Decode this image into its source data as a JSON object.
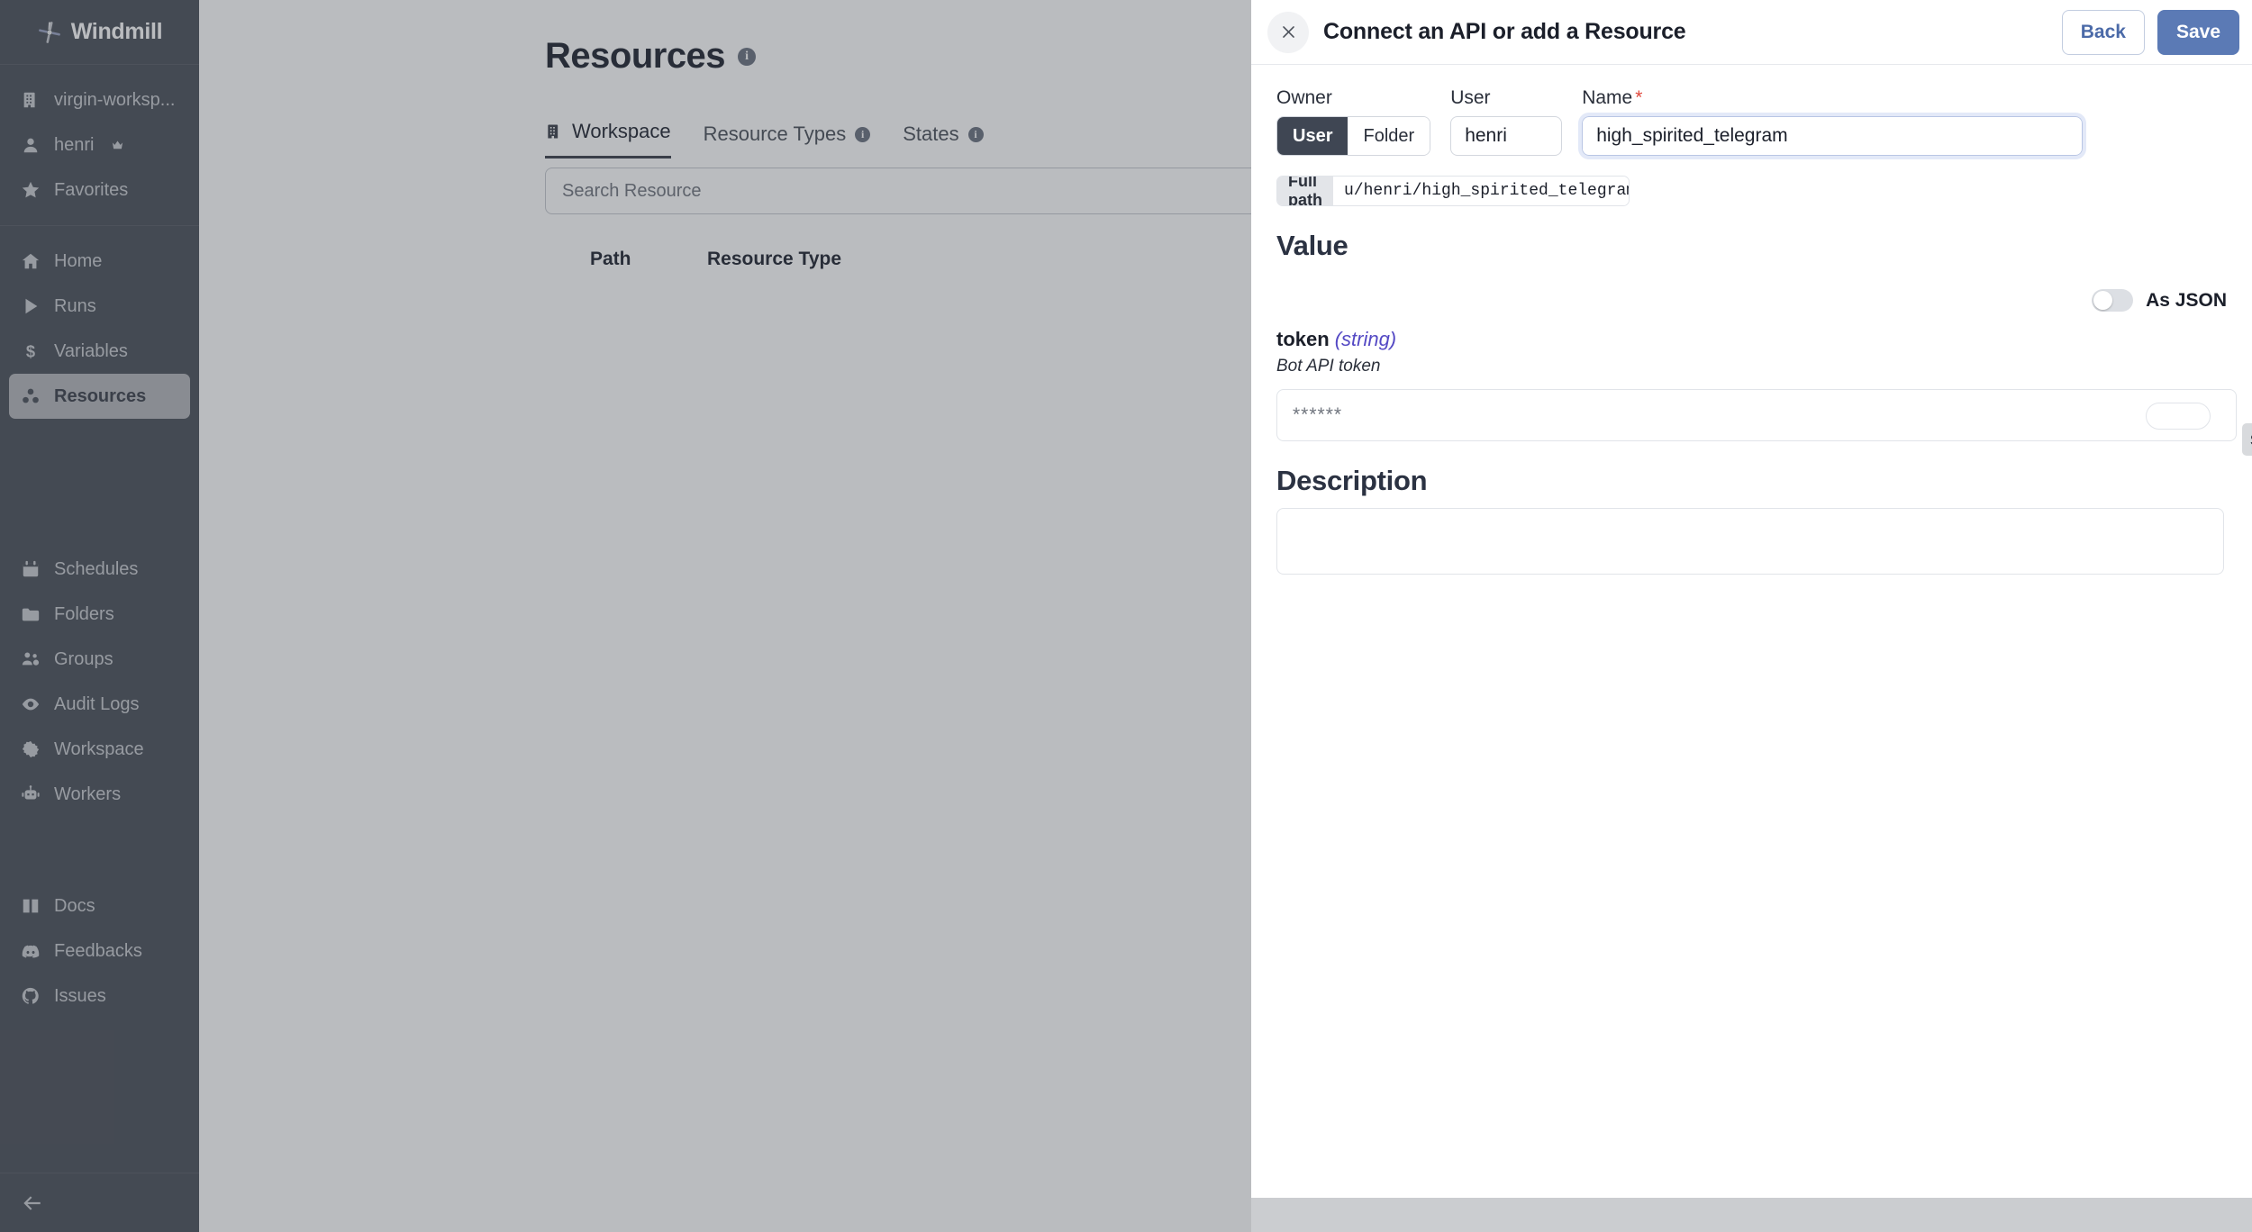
{
  "brand": {
    "name": "Windmill",
    "logo_icon": "windmill-logo-icon"
  },
  "sidebar": {
    "workspace": {
      "label": "virgin-worksp...",
      "icon": "building-icon"
    },
    "user": {
      "label": "henri",
      "icon": "user-icon",
      "badge_icon": "crown-icon"
    },
    "favorites": {
      "label": "Favorites",
      "icon": "star-icon"
    },
    "nav_primary": [
      {
        "label": "Home",
        "icon": "home-icon",
        "active": false
      },
      {
        "label": "Runs",
        "icon": "play-icon",
        "active": false
      },
      {
        "label": "Variables",
        "icon": "dollar-icon",
        "active": false
      },
      {
        "label": "Resources",
        "icon": "resources-icon",
        "active": true
      }
    ],
    "nav_secondary": [
      {
        "label": "Schedules",
        "icon": "calendar-icon"
      },
      {
        "label": "Folders",
        "icon": "folder-icon"
      },
      {
        "label": "Groups",
        "icon": "groups-icon"
      },
      {
        "label": "Audit Logs",
        "icon": "eye-icon"
      },
      {
        "label": "Workspace",
        "icon": "gear-icon"
      },
      {
        "label": "Workers",
        "icon": "robot-icon"
      }
    ],
    "nav_footer": [
      {
        "label": "Docs",
        "icon": "book-icon"
      },
      {
        "label": "Feedbacks",
        "icon": "discord-icon"
      },
      {
        "label": "Issues",
        "icon": "github-icon"
      }
    ],
    "collapse_icon": "arrow-left-icon"
  },
  "page": {
    "title": "Resources",
    "title_info_icon": "info-icon",
    "tabs": [
      {
        "label": "Workspace",
        "icon": "building-icon",
        "active": true,
        "info": false
      },
      {
        "label": "Resource Types",
        "icon": "",
        "active": false,
        "info": true
      },
      {
        "label": "States",
        "icon": "",
        "active": false,
        "info": true
      }
    ],
    "search_placeholder": "Search Resource",
    "search_value": "",
    "table_headers": [
      "Path",
      "Resource Type"
    ]
  },
  "drawer": {
    "title": "Connect an API or add a Resource",
    "close_icon": "close-icon",
    "back_label": "Back",
    "save_label": "Save",
    "owner": {
      "label": "Owner",
      "options": [
        "User",
        "Folder"
      ],
      "selected": "User"
    },
    "user": {
      "label": "User",
      "value": "henri",
      "placeholder": ""
    },
    "name": {
      "label": "Name",
      "required_marker": "*",
      "value": "high_spirited_telegram",
      "placeholder": ""
    },
    "full_path": {
      "label": "Full path",
      "value": "u/henri/high_spirited_telegram"
    },
    "value_section": {
      "title": "Value"
    },
    "as_json": {
      "label": "As JSON",
      "enabled": false
    },
    "property": {
      "name": "token",
      "type": "(string)",
      "description": "Bot API token",
      "masked_value": "******",
      "show_tooltip": "show"
    },
    "description_section": {
      "title": "Description",
      "value": "",
      "placeholder": ""
    }
  },
  "colors": {
    "sidebar_bg": "#4b5059",
    "sidebar_active_bg": "#b4b6ba",
    "save_button": "#5b7ab5",
    "back_button_text": "#4b6aa8",
    "required_marker": "#e0483c",
    "type_text": "#5449c4",
    "owner_selected_bg": "#3f4653"
  }
}
